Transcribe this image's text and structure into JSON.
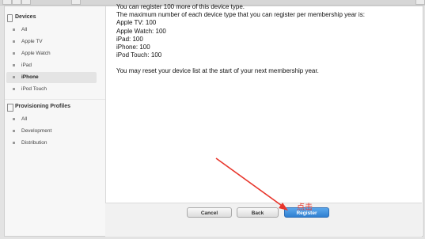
{
  "sidebar": {
    "devices_header": "Devices",
    "device_items": [
      {
        "label": "All",
        "selected": false
      },
      {
        "label": "Apple TV",
        "selected": false
      },
      {
        "label": "Apple Watch",
        "selected": false
      },
      {
        "label": "iPad",
        "selected": false
      },
      {
        "label": "iPhone",
        "selected": true
      },
      {
        "label": "iPod Touch",
        "selected": false
      }
    ],
    "profiles_header": "Provisioning Profiles",
    "profile_items": [
      {
        "label": "All"
      },
      {
        "label": "Development"
      },
      {
        "label": "Distribution"
      }
    ]
  },
  "main": {
    "register_more": "You can register 100 more of this device type.",
    "max_per_type": "The maximum number of each device type that you can register per membership year is:",
    "limits": [
      "Apple TV: 100",
      "Apple Watch: 100",
      "iPad: 100",
      "iPhone: 100",
      "iPod Touch: 100"
    ],
    "reset_note": "You may reset your device list at the start of your next membership year."
  },
  "footer": {
    "cancel_label": "Cancel",
    "back_label": "Back",
    "register_label": "Register"
  },
  "annotation": {
    "text": "点击",
    "color": "#e8352b"
  },
  "colors": {
    "accent_blue": "#2f7fd1",
    "selected_bg": "#e4e4e4"
  }
}
